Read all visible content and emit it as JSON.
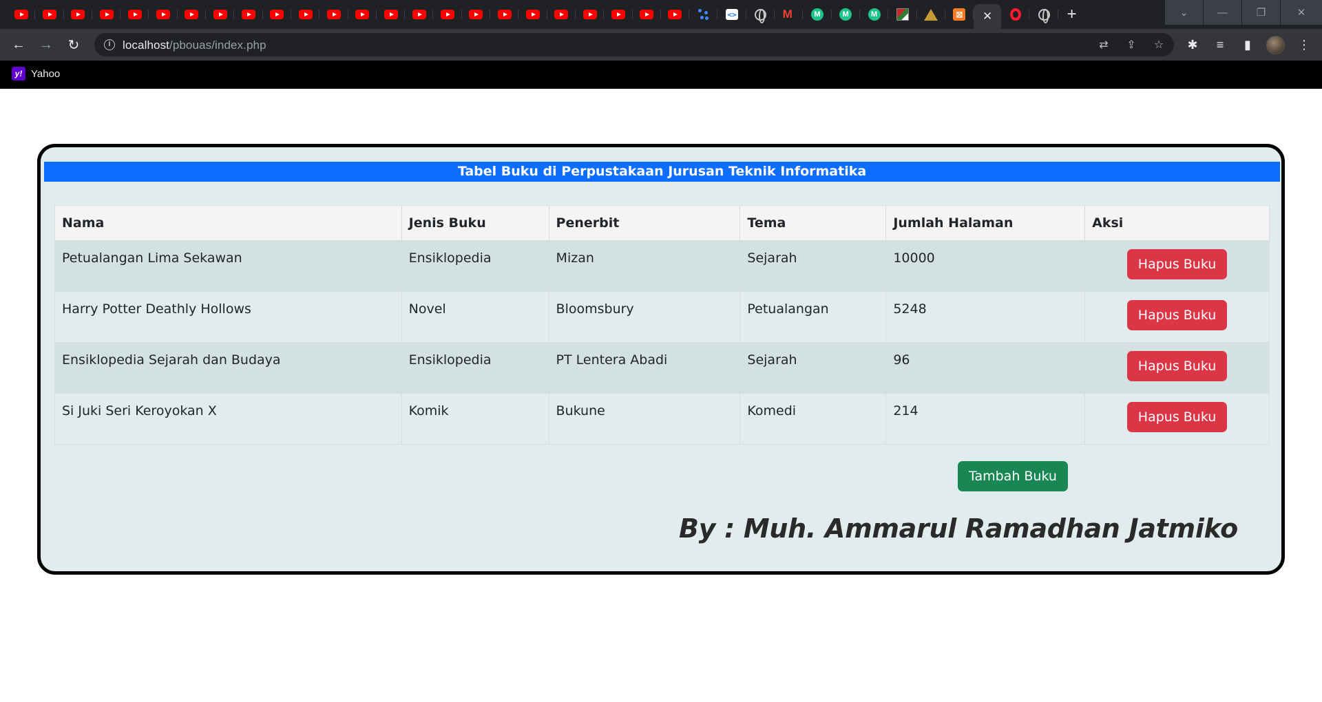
{
  "browser": {
    "tabs": [
      {
        "icon": "youtube-icon"
      },
      {
        "icon": "youtube-icon"
      },
      {
        "icon": "youtube-icon"
      },
      {
        "icon": "youtube-icon"
      },
      {
        "icon": "youtube-icon"
      },
      {
        "icon": "youtube-icon"
      },
      {
        "icon": "youtube-icon"
      },
      {
        "icon": "youtube-icon"
      },
      {
        "icon": "youtube-icon"
      },
      {
        "icon": "youtube-icon"
      },
      {
        "icon": "youtube-icon"
      },
      {
        "icon": "youtube-icon"
      },
      {
        "icon": "youtube-icon"
      },
      {
        "icon": "youtube-icon"
      },
      {
        "icon": "youtube-icon"
      },
      {
        "icon": "youtube-icon"
      },
      {
        "icon": "youtube-icon"
      },
      {
        "icon": "youtube-icon"
      },
      {
        "icon": "youtube-icon"
      },
      {
        "icon": "youtube-icon"
      },
      {
        "icon": "youtube-icon"
      },
      {
        "icon": "youtube-icon"
      },
      {
        "icon": "youtube-icon"
      },
      {
        "icon": "youtube-icon"
      },
      {
        "icon": "colab-icon"
      },
      {
        "icon": "code-icon"
      },
      {
        "icon": "globe-icon"
      },
      {
        "icon": "gmail-icon"
      },
      {
        "icon": "m-icon"
      },
      {
        "icon": "m-icon"
      },
      {
        "icon": "m-icon"
      },
      {
        "icon": "image-icon"
      },
      {
        "icon": "triangle-logo-icon"
      },
      {
        "icon": "xampp-icon"
      }
    ],
    "active_tab": {
      "close_glyph": "✕"
    },
    "after_tabs": [
      {
        "icon": "opera-icon"
      },
      {
        "icon": "globe-icon"
      }
    ],
    "new_tab_glyph": "+",
    "url_host": "localhost",
    "url_path": "/pbouas/index.php",
    "bookmark_label": "Yahoo",
    "colors": {
      "tabstrip": "#202124",
      "toolbar": "#35363a",
      "bookmarks_bar": "#000000"
    }
  },
  "page": {
    "caption": "Tabel Buku di Perpustakaan Jurusan Teknik Informatika",
    "columns": [
      "Nama",
      "Jenis Buku",
      "Penerbit",
      "Tema",
      "Jumlah Halaman",
      "Aksi"
    ],
    "rows": [
      {
        "nama": "Petualangan Lima Sekawan",
        "jenis": "Ensiklopedia",
        "penerbit": "Mizan",
        "tema": "Sejarah",
        "halaman": "10000",
        "aksi": "Hapus Buku"
      },
      {
        "nama": "Harry Potter Deathly Hollows",
        "jenis": "Novel",
        "penerbit": "Bloomsbury",
        "tema": "Petualangan",
        "halaman": "5248",
        "aksi": "Hapus Buku"
      },
      {
        "nama": "Ensiklopedia Sejarah dan Budaya",
        "jenis": "Ensiklopedia",
        "penerbit": "PT Lentera Abadi",
        "tema": "Sejarah",
        "halaman": "96",
        "aksi": "Hapus Buku"
      },
      {
        "nama": "Si Juki Seri Keroyokan X",
        "jenis": "Komik",
        "penerbit": "Bukune",
        "tema": "Komedi",
        "halaman": "214",
        "aksi": "Hapus Buku"
      }
    ],
    "add_button": "Tambah Buku",
    "signature": "By : Muh. Ammarul Ramadhan Jatmiko",
    "colors": {
      "caption_bg": "#0d6efd",
      "danger": "#dc3545",
      "success": "#198754",
      "card_bg": "#e0eced"
    }
  }
}
